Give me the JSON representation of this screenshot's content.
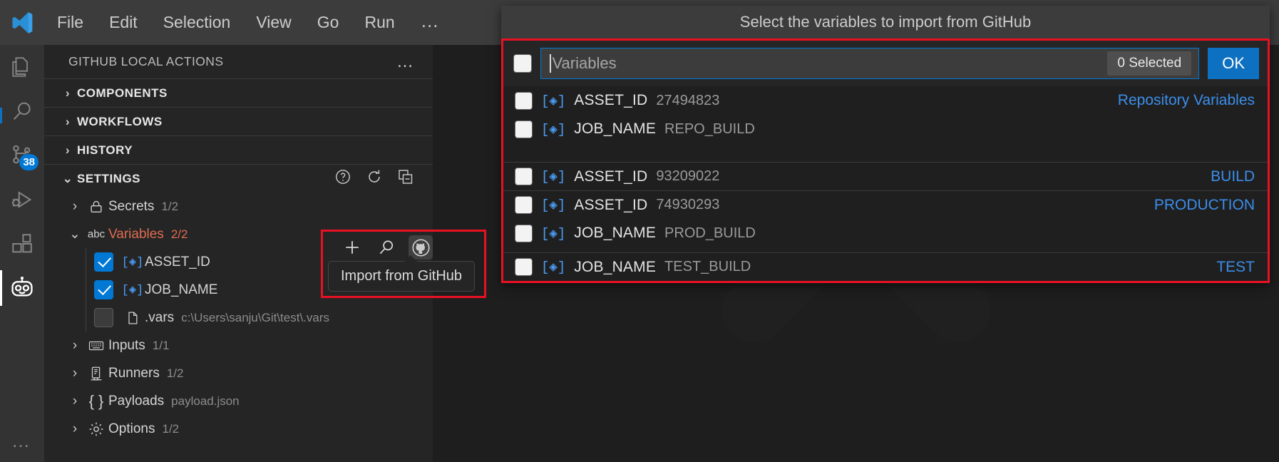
{
  "menubar": {
    "logo_icon": "vscode-logo-icon",
    "items": [
      {
        "label": "File"
      },
      {
        "label": "Edit"
      },
      {
        "label": "Selection"
      },
      {
        "label": "View"
      },
      {
        "label": "Go"
      },
      {
        "label": "Run"
      },
      {
        "label": "…"
      }
    ]
  },
  "activitybar": {
    "items": [
      {
        "icon": "explorer-icon",
        "badge": ""
      },
      {
        "icon": "search-icon",
        "badge": ""
      },
      {
        "icon": "source-control-icon",
        "badge": "38"
      },
      {
        "icon": "run-and-debug-icon",
        "badge": ""
      },
      {
        "icon": "extensions-icon",
        "badge": ""
      },
      {
        "icon": "github-local-actions-robot-icon",
        "badge": ""
      }
    ],
    "more_label": "…"
  },
  "sidebar": {
    "title": "GITHUB LOCAL ACTIONS",
    "more_label": "…",
    "sections": [
      {
        "label": "COMPONENTS",
        "expanded": false
      },
      {
        "label": "WORKFLOWS",
        "expanded": false
      },
      {
        "label": "HISTORY",
        "expanded": false
      },
      {
        "label": "SETTINGS",
        "expanded": true
      }
    ],
    "settings_actions": [
      {
        "icon": "help-icon"
      },
      {
        "icon": "refresh-icon"
      },
      {
        "icon": "collapse-all-icon"
      }
    ],
    "tree": [
      {
        "icon": "lock-icon",
        "label": "Secrets",
        "sub": "1/2",
        "expanded": false
      },
      {
        "icon": "abc-icon",
        "label": "Variables",
        "sub": "2/2",
        "expanded": true,
        "highlight": true
      },
      {
        "icon": "variable-icon",
        "label": "ASSET_ID",
        "sub": "",
        "checked": true,
        "child": true
      },
      {
        "icon": "variable-icon",
        "label": "JOB_NAME",
        "sub": "",
        "checked": true,
        "child": true
      },
      {
        "icon": "file-icon",
        "label": ".vars",
        "sub": "c:\\Users\\sanju\\Git\\test\\.vars",
        "checked": false,
        "child": true
      },
      {
        "icon": "keyboard-icon",
        "label": "Inputs",
        "sub": "1/1",
        "expanded": false
      },
      {
        "icon": "server-icon",
        "label": "Runners",
        "sub": "1/2",
        "expanded": false
      },
      {
        "icon": "braces-icon",
        "label": "Payloads",
        "sub": "payload.json",
        "expanded": false
      },
      {
        "icon": "gear-icon",
        "label": "Options",
        "sub": "1/2",
        "expanded": false
      }
    ]
  },
  "import_toolbar": {
    "buttons": [
      {
        "icon": "plus-icon"
      },
      {
        "icon": "search-icon"
      },
      {
        "icon": "github-icon"
      }
    ],
    "tooltip": "Import from GitHub"
  },
  "dialog": {
    "title": "Select the variables to import from GitHub",
    "search_placeholder": "Variables",
    "search_value": "",
    "selected_count_label": "0 Selected",
    "ok_label": "OK",
    "all_checked": false,
    "rows": [
      {
        "icon": "variable-icon",
        "name": "ASSET_ID",
        "value": "27494823",
        "group": "Repository Variables",
        "checked": false,
        "separator": false
      },
      {
        "icon": "variable-icon",
        "name": "JOB_NAME",
        "value": "REPO_BUILD",
        "group": "",
        "checked": false,
        "separator": false
      },
      {
        "icon": "variable-icon",
        "name": "ASSET_ID",
        "value": "93209022",
        "group": "BUILD",
        "checked": false,
        "separator": true
      },
      {
        "icon": "variable-icon",
        "name": "ASSET_ID",
        "value": "74930293",
        "group": "PRODUCTION",
        "checked": false,
        "separator": true
      },
      {
        "icon": "variable-icon",
        "name": "JOB_NAME",
        "value": "PROD_BUILD",
        "group": "",
        "checked": false,
        "separator": false
      },
      {
        "icon": "variable-icon",
        "name": "JOB_NAME",
        "value": "TEST_BUILD",
        "group": "TEST",
        "checked": false,
        "separator": true
      }
    ]
  },
  "colors": {
    "accent_blue": "#0078d4",
    "link_blue": "#3b8eea",
    "highlight_red": "#e81123",
    "variable_orange": "#e06c4f",
    "editor_bg": "#1e1e1e",
    "sidebar_bg": "#252526",
    "titlebar_bg": "#3c3c3c"
  }
}
